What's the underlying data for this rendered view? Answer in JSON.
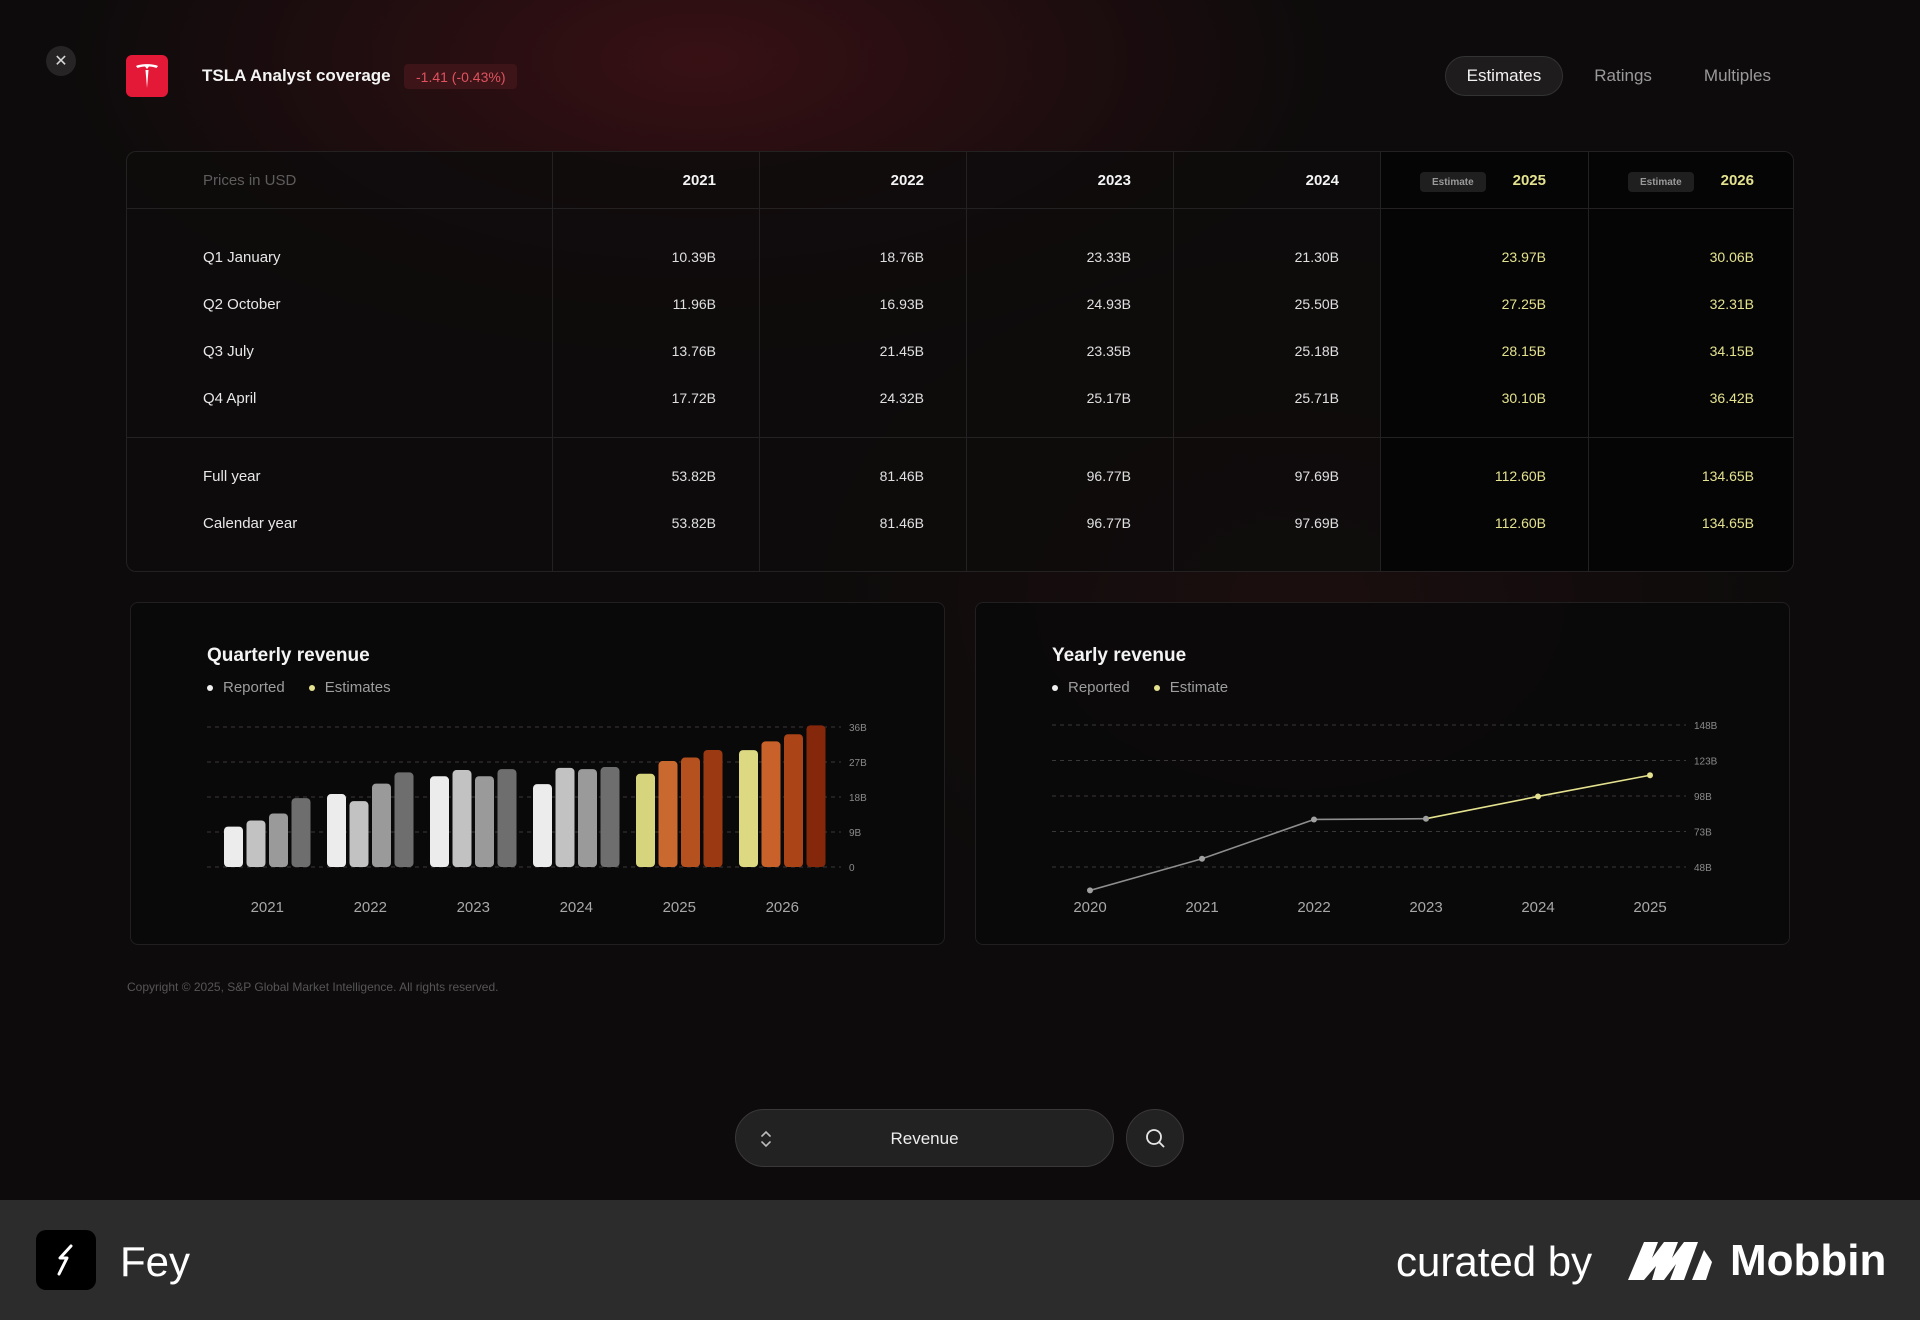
{
  "header": {
    "title": "TSLA Analyst coverage",
    "change": "-1.41 (-0.43%)",
    "close_icon": "close-icon",
    "logo_icon": "tesla-logo-icon",
    "tabs": [
      {
        "label": "Estimates",
        "active": true
      },
      {
        "label": "Ratings",
        "active": false
      },
      {
        "label": "Multiples",
        "active": false
      }
    ]
  },
  "table": {
    "currency_label": "Prices in USD",
    "estimate_chip": "Estimate",
    "years": [
      "2021",
      "2022",
      "2023",
      "2024",
      "2025",
      "2026"
    ],
    "estimate_years": [
      "2025",
      "2026"
    ],
    "quarter_rows": [
      {
        "label": "Q1 January",
        "values": [
          "10.39B",
          "18.76B",
          "23.33B",
          "21.30B",
          "23.97B",
          "30.06B"
        ]
      },
      {
        "label": "Q2 October",
        "values": [
          "11.96B",
          "16.93B",
          "24.93B",
          "25.50B",
          "27.25B",
          "32.31B"
        ]
      },
      {
        "label": "Q3 July",
        "values": [
          "13.76B",
          "21.45B",
          "23.35B",
          "25.18B",
          "28.15B",
          "34.15B"
        ]
      },
      {
        "label": "Q4 April",
        "values": [
          "17.72B",
          "24.32B",
          "25.17B",
          "25.71B",
          "30.10B",
          "36.42B"
        ]
      }
    ],
    "total_rows": [
      {
        "label": "Full year",
        "values": [
          "53.82B",
          "81.46B",
          "96.77B",
          "97.69B",
          "112.60B",
          "134.65B"
        ]
      },
      {
        "label": "Calendar year",
        "values": [
          "53.82B",
          "81.46B",
          "96.77B",
          "97.69B",
          "112.60B",
          "134.65B"
        ]
      }
    ]
  },
  "colors": {
    "accent_estimate": "#e4e28e",
    "negative": "#e0525e",
    "brand": "#e31937"
  },
  "chart_data": [
    {
      "type": "bar",
      "title": "Quarterly revenue",
      "legend": [
        "Reported",
        "Estimates"
      ],
      "legend_position": "top-left",
      "categories": [
        "2021",
        "2022",
        "2023",
        "2024",
        "2025",
        "2026"
      ],
      "series": [
        {
          "name": "Q1",
          "values": [
            10.39,
            18.76,
            23.33,
            21.3,
            23.97,
            30.06
          ]
        },
        {
          "name": "Q2",
          "values": [
            11.96,
            16.93,
            24.93,
            25.5,
            27.25,
            32.31
          ]
        },
        {
          "name": "Q3",
          "values": [
            13.76,
            21.45,
            23.35,
            25.18,
            28.15,
            34.15
          ]
        },
        {
          "name": "Q4",
          "values": [
            17.72,
            24.32,
            25.17,
            25.71,
            30.1,
            36.42
          ]
        }
      ],
      "estimate_categories": [
        "2025",
        "2026"
      ],
      "y_ticks": [
        "0",
        "9B",
        "18B",
        "27B",
        "36B"
      ],
      "ylim": [
        0,
        36
      ],
      "grid": true
    },
    {
      "type": "line",
      "title": "Yearly revenue",
      "legend": [
        "Reported",
        "Estimate"
      ],
      "legend_position": "top-left",
      "x": [
        "2020",
        "2021",
        "2022",
        "2023",
        "2024",
        "2025"
      ],
      "values": [
        31.5,
        53.82,
        81.46,
        82.0,
        97.69,
        112.6
      ],
      "estimate_from": "2023",
      "y_ticks": [
        "48B",
        "73B",
        "98B",
        "123B",
        "148B"
      ],
      "ylim": [
        48,
        148
      ],
      "grid": true
    }
  ],
  "copyright": "Copyright © 2025, S&P Global Market Intelligence. All rights reserved.",
  "search": {
    "label": "Revenue",
    "sort_icon": "sort-chevrons-icon",
    "search_icon": "search-icon"
  },
  "footer": {
    "app_name": "Fey",
    "curated_by": "curated by",
    "brand": "Mobbin"
  }
}
